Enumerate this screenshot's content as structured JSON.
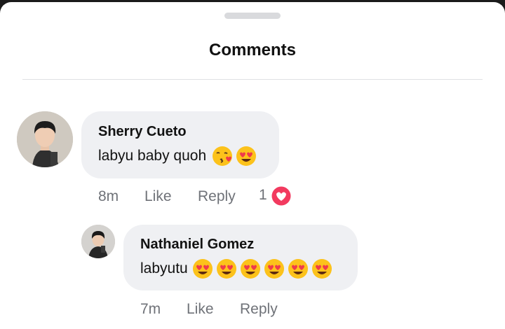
{
  "sheet": {
    "title": "Comments"
  },
  "comments": [
    {
      "author": "Sherry Cueto",
      "text": "labyu baby quoh",
      "emojis": [
        "face-blowing-kiss",
        "heart-eyes"
      ],
      "time": "8m",
      "like_label": "Like",
      "reply_label": "Reply",
      "reaction_count": "1",
      "reaction_icon": "heart-reaction-icon"
    },
    {
      "author": "Nathaniel Gomez",
      "text": "labyutu",
      "emojis": [
        "heart-eyes",
        "heart-eyes",
        "heart-eyes",
        "heart-eyes",
        "heart-eyes",
        "heart-eyes"
      ],
      "time": "7m",
      "like_label": "Like",
      "reply_label": "Reply"
    }
  ],
  "colors": {
    "bubble": "#eff0f3",
    "action": "#6f7278",
    "heart": "#f23a5f"
  }
}
